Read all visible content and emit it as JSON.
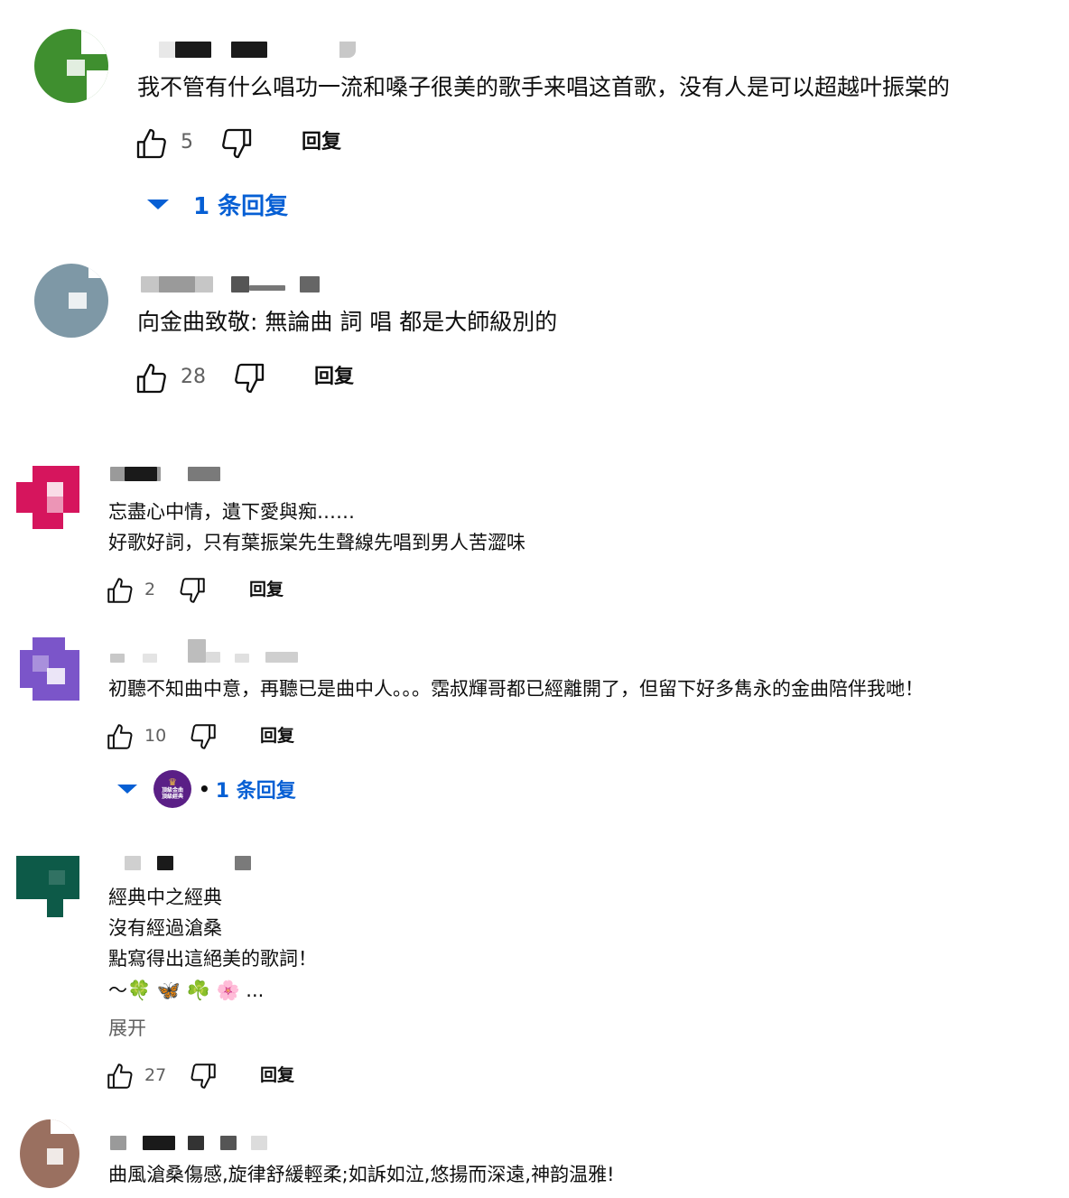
{
  "comments": [
    {
      "avatar_color": "#3f8f2f",
      "lines": [
        "我不管有什么唱功一流和嗓子很美的歌手来唱这首歌，没有人是可以超越叶振棠的"
      ],
      "likes": "5",
      "reply_label": "回复",
      "replies_label": "1 条回复"
    },
    {
      "avatar_color": "#7e98a6",
      "lines": [
        "向金曲致敬: 無論曲 詞 唱 都是大師級別的"
      ],
      "likes": "28",
      "reply_label": "回复"
    },
    {
      "avatar_color": "#d6155d",
      "lines": [
        "忘盡心中情，遺下愛與痴……",
        "好歌好詞，只有葉振棠先生聲線先唱到男人苦澀味"
      ],
      "likes": "2",
      "reply_label": "回复"
    },
    {
      "avatar_color": "#7b55c9",
      "lines": [
        "初聽不知曲中意，再聽已是曲中人。。。霑叔輝哥都已經離開了，但留下好多雋永的金曲陪伴我哋！"
      ],
      "likes": "10",
      "reply_label": "回复",
      "replies_label": "1 条回复",
      "reply_avatar_text": "頂級金曲\n頂級經典"
    },
    {
      "avatar_color": "#0d5a48",
      "lines": [
        "經典中之經典",
        "沒有經過滄桑",
        "點寫得出這絕美的歌詞！",
        "～🍀 🦋 ☘️ 🌸 ..."
      ],
      "expand_label": "展开",
      "likes": "27",
      "reply_label": "回复"
    },
    {
      "avatar_color": "#9a7060",
      "lines": [
        "曲風滄桑傷感,旋律舒緩輕柔;如訴如泣,悠揚而深遠,神韵温雅!"
      ]
    }
  ]
}
